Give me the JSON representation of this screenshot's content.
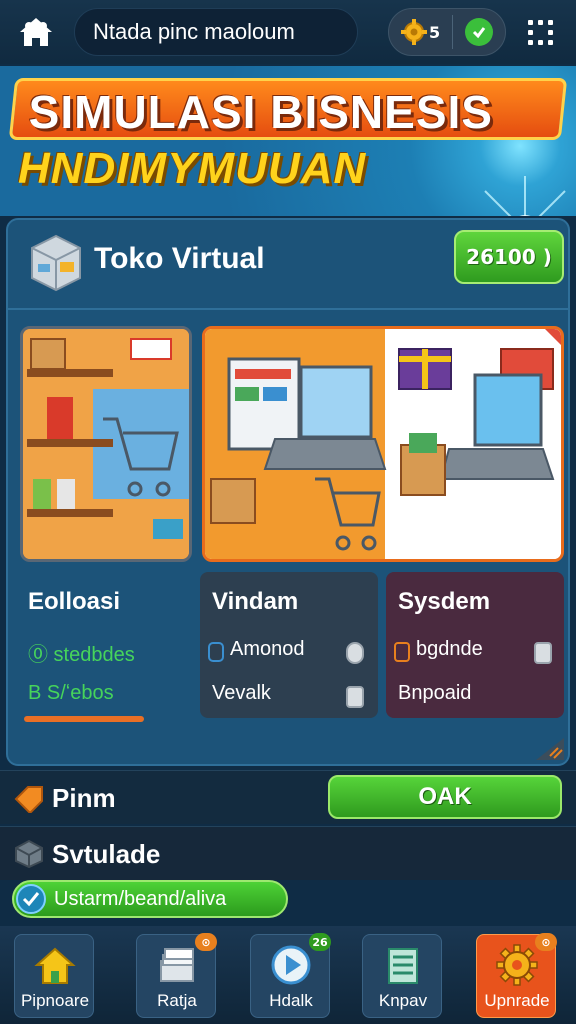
{
  "topbar": {
    "search_text": "Ntada pinc maoloum",
    "coins": "5",
    "colors": {
      "accent_green": "#3bbf3b",
      "gold": "#f5b21a"
    }
  },
  "banner": {
    "title_line1": "SIMULASI BISNESIS",
    "title_line2": "HNDIMYMUUAN"
  },
  "store": {
    "name": "Toko Virtual",
    "cash": "26100 )"
  },
  "stats": [
    {
      "title": "Eolloasi",
      "line1": "⓪ stedbdes",
      "line2": "B S/ʻebos",
      "line1_color": "#46d45b",
      "line2_color": "#46d45b"
    },
    {
      "title": "Vindam",
      "line1": "Amonod",
      "line2": "Vevalk",
      "line1_color": "#ffffff",
      "line2_color": "#ffffff"
    },
    {
      "title": "Sysdem",
      "line1": "bgdnde",
      "line2": "Bnpoaid",
      "line1_color": "#ffffff",
      "line2_color": "#ffffff"
    }
  ],
  "options": {
    "row1_label": "Pinm",
    "row1_button": "OAK",
    "row2_label": "Svtulade",
    "toggle_label": "Ustarm/beand/aliva"
  },
  "nav": [
    {
      "label": "Pipnoare",
      "icon": "house-icon",
      "badge": ""
    },
    {
      "label": "Ratja",
      "icon": "papers-icon",
      "badge": "⊙"
    },
    {
      "label": "Hdalk",
      "icon": "play-icon",
      "badge": "26"
    },
    {
      "label": "Knpav",
      "icon": "list-icon",
      "badge": ""
    },
    {
      "label": "Upnrade",
      "icon": "gear-icon",
      "badge": "⊙"
    }
  ]
}
